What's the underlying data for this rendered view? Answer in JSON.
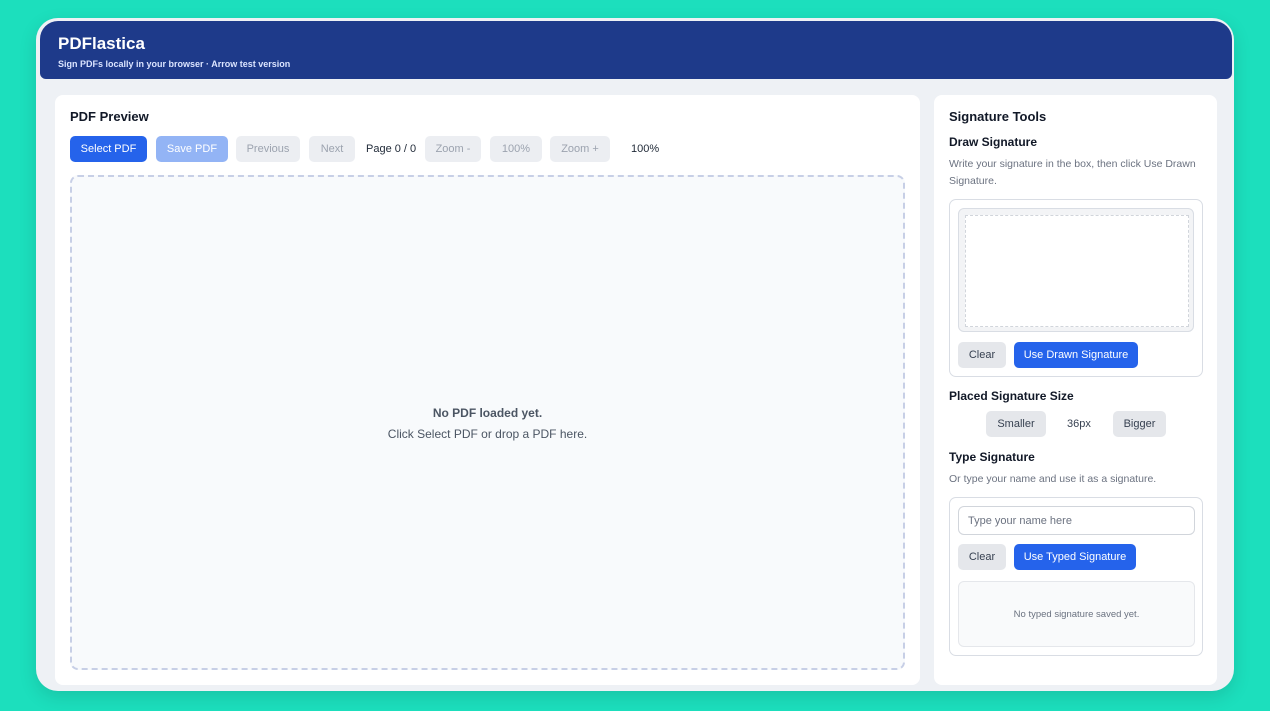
{
  "app": {
    "title": "PDFlastica",
    "subtitle": "Sign PDFs locally in your browser · Arrow test version"
  },
  "preview": {
    "title": "PDF Preview",
    "toolbar": {
      "select_pdf": "Select PDF",
      "save_pdf": "Save PDF",
      "previous": "Previous",
      "next": "Next",
      "page_indicator": "Page 0 / 0",
      "zoom_out": "Zoom -",
      "zoom_reset": "100%",
      "zoom_in": "Zoom +",
      "zoom_level": "100%"
    },
    "dropzone": {
      "title": "No PDF loaded yet.",
      "hint": "Click Select PDF or drop a PDF here."
    }
  },
  "tools": {
    "title": "Signature Tools",
    "draw": {
      "title": "Draw Signature",
      "help": "Write your signature in the box, then click Use Drawn Signature.",
      "clear": "Clear",
      "use": "Use Drawn Signature"
    },
    "size": {
      "title": "Placed Signature Size",
      "smaller": "Smaller",
      "value": "36px",
      "bigger": "Bigger"
    },
    "type": {
      "title": "Type Signature",
      "help": "Or type your name and use it as a signature.",
      "placeholder": "Type your name here",
      "clear": "Clear",
      "use": "Use Typed Signature",
      "preview_empty": "No typed signature saved yet."
    }
  },
  "colors": {
    "background": "#1cdfbd",
    "header": "#1e3a8a",
    "primary": "#2563eb"
  }
}
